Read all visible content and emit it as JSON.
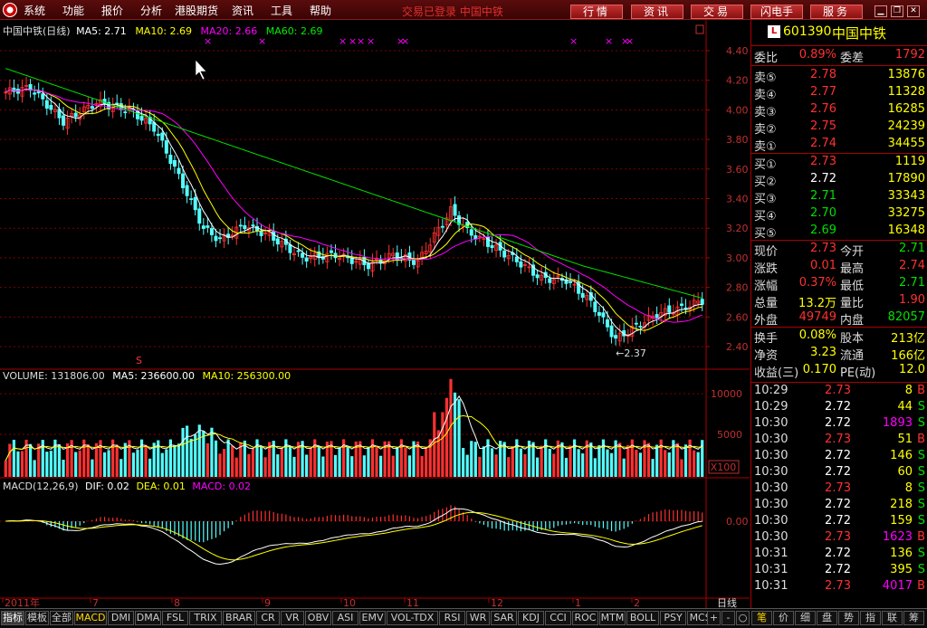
{
  "menubar": {
    "items": [
      "系统",
      "功能",
      "报价",
      "分析",
      "港股期货",
      "资讯",
      "工具",
      "帮助"
    ],
    "status": "交易已登录  中国中铁",
    "nav_buttons": [
      "行情",
      "资讯",
      "交易",
      "闪电手",
      "服务"
    ]
  },
  "chart": {
    "main_legend": {
      "name": "中国中铁(日线)",
      "ma5": "MA5: 2.71",
      "ma10": "MA10: 2.69",
      "ma20": "MA20: 2.66",
      "ma60": "MA60: 2.69"
    },
    "price_ticks": [
      "4.40",
      "4.20",
      "4.00",
      "3.80",
      "3.60",
      "3.40",
      "3.20",
      "3.00",
      "2.80",
      "2.60",
      "2.40"
    ],
    "low_marker": "←2.37",
    "s_marker": "S",
    "volume_legend": {
      "vol": "VOLUME: 131806.00",
      "ma5": "MA5: 236600.00",
      "ma10": "MA10: 256300.00"
    },
    "volume_ticks": [
      "10000",
      "5000"
    ],
    "volume_unit": "X100",
    "macd_legend": {
      "name": "MACD(12,26,9)",
      "dif": "DIF: 0.02",
      "dea": "DEA: 0.01",
      "macd": "MACD: 0.02"
    },
    "macd_tick": "0.00",
    "x_labels": [
      "2011年",
      "7",
      "8",
      "9",
      "10",
      "11",
      "12",
      "1",
      "2"
    ],
    "period": "日线",
    "colors": {
      "up": "#ff3030",
      "down": "#54ffff",
      "ma5": "#ffffff",
      "ma10": "#ffff00",
      "ma20": "#ff00ff",
      "ma60": "#00e000",
      "grid": "#800000"
    }
  },
  "quote": {
    "code": "601390",
    "name": "中国中铁",
    "weibi": {
      "l1": "委比",
      "v1": "0.89%",
      "l2": "委差",
      "v2": "1792"
    },
    "sells": [
      {
        "label": "卖⑤",
        "price": "2.78",
        "vol": "13876"
      },
      {
        "label": "卖④",
        "price": "2.77",
        "vol": "11328"
      },
      {
        "label": "卖③",
        "price": "2.76",
        "vol": "16285"
      },
      {
        "label": "卖②",
        "price": "2.75",
        "vol": "24239"
      },
      {
        "label": "卖①",
        "price": "2.74",
        "vol": "34455"
      }
    ],
    "buys": [
      {
        "label": "买①",
        "price": "2.73",
        "vol": "1119",
        "pc": "#ff3030"
      },
      {
        "label": "买②",
        "price": "2.72",
        "vol": "17890",
        "pc": "#ffffff"
      },
      {
        "label": "买③",
        "price": "2.71",
        "vol": "33343",
        "pc": "#00e000"
      },
      {
        "label": "买④",
        "price": "2.70",
        "vol": "33275",
        "pc": "#00e000"
      },
      {
        "label": "买⑤",
        "price": "2.69",
        "vol": "16348",
        "pc": "#00e000"
      }
    ],
    "stats": [
      {
        "l1": "现价",
        "v1": "2.73",
        "c1": "#ff3030",
        "l2": "今开",
        "v2": "2.71",
        "c2": "#00e000"
      },
      {
        "l1": "涨跌",
        "v1": "0.01",
        "c1": "#ff3030",
        "l2": "最高",
        "v2": "2.74",
        "c2": "#ff3030"
      },
      {
        "l1": "涨幅",
        "v1": "0.37%",
        "c1": "#ff3030",
        "l2": "最低",
        "v2": "2.71",
        "c2": "#00e000"
      },
      {
        "l1": "总量",
        "v1": "13.2万",
        "c1": "#ffff00",
        "l2": "量比",
        "v2": "1.90",
        "c2": "#ff3030"
      },
      {
        "l1": "外盘",
        "v1": "49749",
        "c1": "#ff3030",
        "l2": "内盘",
        "v2": "82057",
        "c2": "#00e000"
      }
    ],
    "stats2": [
      {
        "l1": "换手",
        "v1": "0.08%",
        "l2": "股本",
        "v2": "213亿"
      },
      {
        "l1": "净资",
        "v1": "3.23",
        "l2": "流通",
        "v2": "166亿"
      },
      {
        "l1": "收益(三)",
        "v1": "0.170",
        "l2": "PE(动)",
        "v2": "12.0"
      }
    ],
    "ticks": [
      {
        "time": "10:29",
        "price": "2.73",
        "vol": "8",
        "bs": "B"
      },
      {
        "time": "10:29",
        "price": "2.72",
        "vol": "44",
        "bs": "S"
      },
      {
        "time": "10:30",
        "price": "2.72",
        "vol": "1893",
        "bs": "S"
      },
      {
        "time": "10:30",
        "price": "2.73",
        "vol": "51",
        "bs": "B"
      },
      {
        "time": "10:30",
        "price": "2.72",
        "vol": "146",
        "bs": "S"
      },
      {
        "time": "10:30",
        "price": "2.72",
        "vol": "60",
        "bs": "S"
      },
      {
        "time": "10:30",
        "price": "2.73",
        "vol": "8",
        "bs": "S"
      },
      {
        "time": "10:30",
        "price": "2.72",
        "vol": "218",
        "bs": "S"
      },
      {
        "time": "10:30",
        "price": "2.72",
        "vol": "159",
        "bs": "S"
      },
      {
        "time": "10:30",
        "price": "2.73",
        "vol": "1623",
        "bs": "B"
      },
      {
        "time": "10:31",
        "price": "2.72",
        "vol": "136",
        "bs": "S"
      },
      {
        "time": "10:31",
        "price": "2.72",
        "vol": "395",
        "bs": "S"
      },
      {
        "time": "10:31",
        "price": "2.73",
        "vol": "4017",
        "bs": "B"
      }
    ]
  },
  "bottom_tabs": [
    "指标",
    "模板",
    "全部",
    "MACD",
    "DMI",
    "DMA",
    "FSL",
    "TRIX",
    "BRAR",
    "CR",
    "VR",
    "OBV",
    "ASI",
    "EMV",
    "VOL-TDX",
    "RSI",
    "WR",
    "SAR",
    "KDJ",
    "CCI",
    "ROC",
    "MTM",
    "BOLL",
    "PSY",
    "MCST"
  ],
  "bottom_right": [
    "+",
    "-",
    "○",
    "笔",
    "价",
    "细",
    "盘",
    "势",
    "指",
    "联",
    "筹"
  ]
}
